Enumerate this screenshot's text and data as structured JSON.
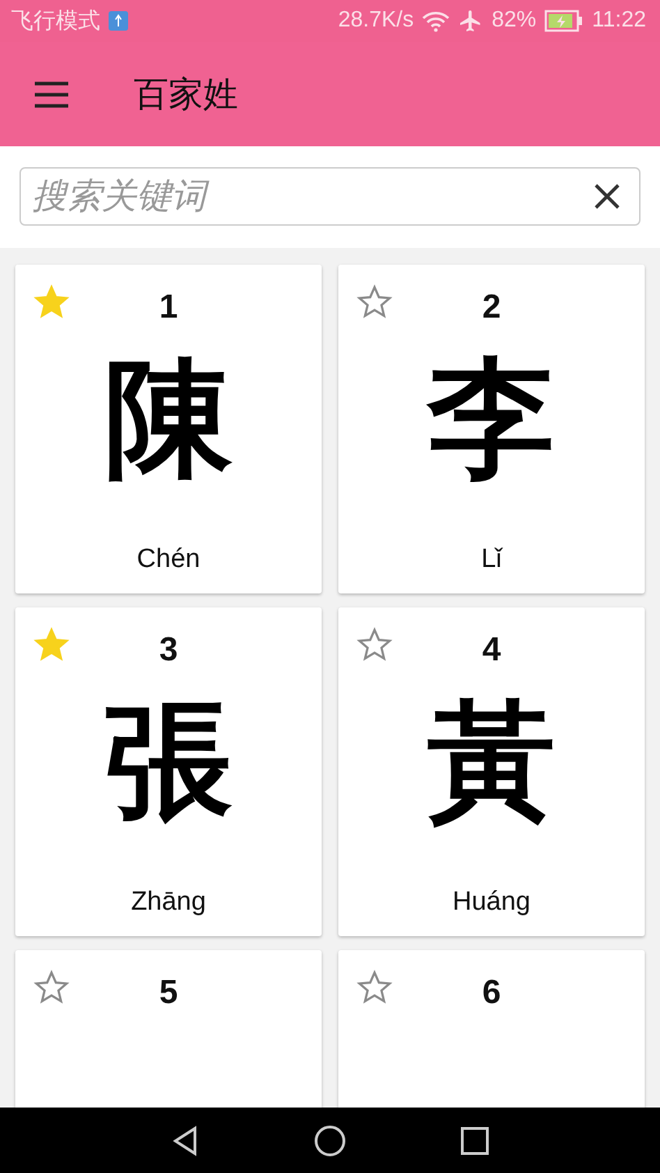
{
  "status_bar": {
    "mode": "飞行模式",
    "speed": "28.7K/s",
    "battery": "82%",
    "time": "11:22"
  },
  "app_bar": {
    "title": "百家姓"
  },
  "search": {
    "placeholder": "搜索关键词"
  },
  "cards": [
    {
      "number": "1",
      "character": "陳",
      "pinyin": "Chén",
      "favorite": true
    },
    {
      "number": "2",
      "character": "李",
      "pinyin": "Lǐ",
      "favorite": false
    },
    {
      "number": "3",
      "character": "張",
      "pinyin": "Zhāng",
      "favorite": true
    },
    {
      "number": "4",
      "character": "黃",
      "pinyin": "Huáng",
      "favorite": false
    },
    {
      "number": "5",
      "favorite": false
    },
    {
      "number": "6",
      "favorite": false
    }
  ]
}
